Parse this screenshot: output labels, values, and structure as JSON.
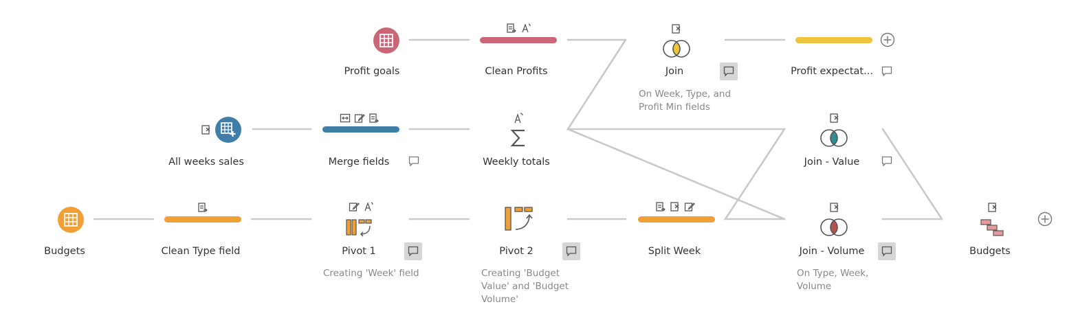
{
  "colors": {
    "connector": "#c9c9c9",
    "red": "#cc6677",
    "blue": "#3f7ea6",
    "orange": "#f0a035",
    "yellow": "#eec43c",
    "teal": "#2f8f8f",
    "label": "#333333",
    "description": "#888888"
  },
  "nodes": {
    "profit_goals": {
      "label": "Profit goals",
      "icon": "table-icon"
    },
    "clean_profits": {
      "label": "Clean Profits",
      "icon": "clean-bar-icon"
    },
    "join": {
      "label": "Join",
      "description": [
        "On Week, Type, and",
        "Profit Min fields"
      ],
      "icon": "join-inner-icon"
    },
    "profit_expectations": {
      "label": "Profit expectat...",
      "icon": "output-bar-icon"
    },
    "all_weeks_sales": {
      "label": "All weeks sales",
      "icon": "table-plus-icon"
    },
    "merge_fields": {
      "label": "Merge fields",
      "icon": "clean-bar-icon"
    },
    "weekly_totals": {
      "label": "Weekly totals",
      "icon": "sigma-icon"
    },
    "join_value": {
      "label": "Join - Value",
      "icon": "join-icon"
    },
    "budgets_input": {
      "label": "Budgets",
      "icon": "table-icon"
    },
    "clean_type_field": {
      "label": "Clean Type field",
      "icon": "clean-bar-icon"
    },
    "pivot_1": {
      "label": "Pivot 1",
      "description": [
        "Creating 'Week' field"
      ],
      "icon": "pivot-icon"
    },
    "pivot_2": {
      "label": "Pivot 2",
      "description": [
        "Creating 'Budget",
        "Value' and 'Budget",
        "Volume'"
      ],
      "icon": "pivot-icon"
    },
    "split_week": {
      "label": "Split Week",
      "icon": "clean-bar-icon"
    },
    "join_volume": {
      "label": "Join - Volume",
      "description": [
        "On Type, Week,",
        "Volume"
      ],
      "icon": "join-icon"
    },
    "budgets_output": {
      "label": "Budgets",
      "icon": "output-icon"
    }
  }
}
